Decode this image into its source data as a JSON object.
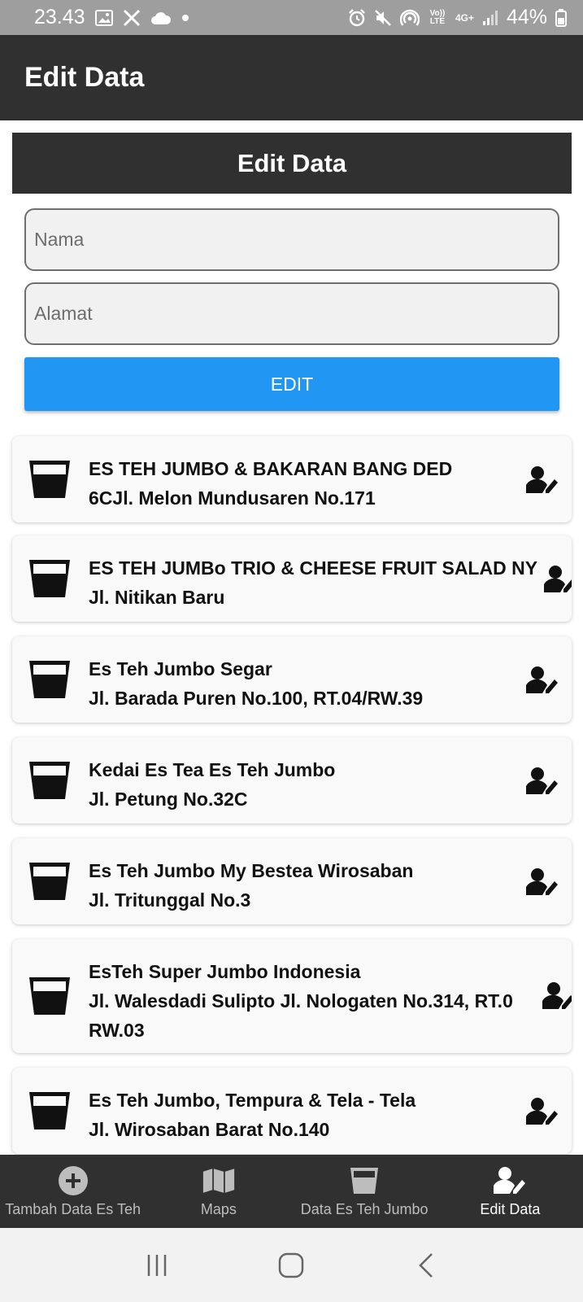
{
  "status_bar": {
    "time": "23.43",
    "network_label": "4G+",
    "volte_label": "Vo)) LTE",
    "battery": "44%"
  },
  "app_bar": {
    "title": "Edit Data"
  },
  "form": {
    "header": "Edit Data",
    "name_placeholder": "Nama",
    "address_placeholder": "Alamat",
    "edit_label": "EDIT"
  },
  "items": [
    {
      "name": "ES TEH JUMBO & BAKARAN BANG DED",
      "address": "6CJl. Melon Mundusaren No.171"
    },
    {
      "name": "ES TEH JUMBo TRIO & CHEESE FRUIT SALAD NY",
      "address": "Jl. Nitikan Baru"
    },
    {
      "name": "Es Teh Jumbo Segar",
      "address": "Jl. Barada Puren No.100, RT.04/RW.39"
    },
    {
      "name": "Kedai Es Tea Es Teh Jumbo",
      "address": "Jl. Petung No.32C"
    },
    {
      "name": "Es Teh Jumbo My Bestea Wirosaban",
      "address": "Jl. Tritunggal No.3"
    },
    {
      "name": "EsTeh Super Jumbo Indonesia",
      "address": "Jl. Walesdadi Sulipto Jl. Nologaten No.314, RT.0 RW.03"
    },
    {
      "name": "Es Teh Jumbo, Tempura & Tela - Tela",
      "address": "Jl. Wirosaban Barat No.140"
    }
  ],
  "bottom_nav": [
    {
      "label": "Tambah Data Es Teh",
      "icon": "add-circle-icon"
    },
    {
      "label": "Maps",
      "icon": "map-icon"
    },
    {
      "label": "Data Es Teh Jumbo",
      "icon": "glass-icon"
    },
    {
      "label": "Edit Data",
      "icon": "user-edit-icon",
      "active": true
    }
  ],
  "colors": {
    "app_bar": "#303030",
    "button": "#2196f3",
    "status_bar": "#9e9e9e"
  }
}
